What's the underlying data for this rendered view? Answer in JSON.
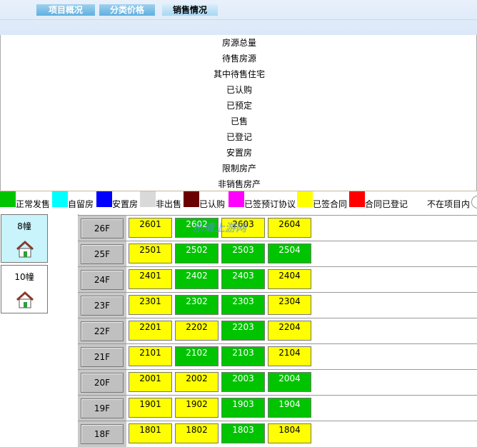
{
  "tabs": [
    {
      "label": "项目概况",
      "active": false
    },
    {
      "label": "分类价格",
      "active": false
    },
    {
      "label": "销售情况",
      "active": true
    }
  ],
  "summary": [
    "房源总量",
    "待售房源",
    "其中待售住宅",
    "已认购",
    "已预定",
    "已售",
    "已登记",
    "安置房",
    "限制房产",
    "非销售房产"
  ],
  "legend": [
    {
      "label": "正常发售",
      "color": "#00c400"
    },
    {
      "label": "自留房",
      "color": "#00ffff"
    },
    {
      "label": "安置房",
      "color": "#0000ff"
    },
    {
      "label": "非出售",
      "color": "#d9d9d9"
    },
    {
      "label": "已认购",
      "color": "#6b0000"
    },
    {
      "label": "已签预订协议",
      "color": "#ff00ff"
    },
    {
      "label": "已签合同",
      "color": "#ffff00"
    },
    {
      "label": "合同已登记",
      "color": "#ff0000"
    },
    {
      "label": "不在项目内",
      "color": "#ffffff"
    }
  ],
  "buildings": [
    {
      "name": "8幢",
      "active": true
    },
    {
      "name": "10幢",
      "active": false
    }
  ],
  "watermark": "乐清上游网",
  "floors": [
    {
      "label": "26F",
      "units": [
        {
          "no": "2601",
          "status": "yellow"
        },
        {
          "no": "2602",
          "status": "green"
        },
        {
          "no": "2603",
          "status": "yellow"
        },
        {
          "no": "2604",
          "status": "yellow"
        }
      ]
    },
    {
      "label": "25F",
      "units": [
        {
          "no": "2501",
          "status": "yellow"
        },
        {
          "no": "2502",
          "status": "green"
        },
        {
          "no": "2503",
          "status": "green"
        },
        {
          "no": "2504",
          "status": "green"
        }
      ]
    },
    {
      "label": "24F",
      "units": [
        {
          "no": "2401",
          "status": "yellow"
        },
        {
          "no": "2402",
          "status": "green"
        },
        {
          "no": "2403",
          "status": "green"
        },
        {
          "no": "2404",
          "status": "yellow"
        }
      ]
    },
    {
      "label": "23F",
      "units": [
        {
          "no": "2301",
          "status": "yellow"
        },
        {
          "no": "2302",
          "status": "green"
        },
        {
          "no": "2303",
          "status": "green"
        },
        {
          "no": "2304",
          "status": "yellow"
        }
      ]
    },
    {
      "label": "22F",
      "units": [
        {
          "no": "2201",
          "status": "yellow"
        },
        {
          "no": "2202",
          "status": "yellow"
        },
        {
          "no": "2203",
          "status": "green"
        },
        {
          "no": "2204",
          "status": "yellow"
        }
      ]
    },
    {
      "label": "21F",
      "units": [
        {
          "no": "2101",
          "status": "yellow"
        },
        {
          "no": "2102",
          "status": "green"
        },
        {
          "no": "2103",
          "status": "green"
        },
        {
          "no": "2104",
          "status": "yellow"
        }
      ]
    },
    {
      "label": "20F",
      "units": [
        {
          "no": "2001",
          "status": "yellow"
        },
        {
          "no": "2002",
          "status": "yellow"
        },
        {
          "no": "2003",
          "status": "green"
        },
        {
          "no": "2004",
          "status": "green"
        }
      ]
    },
    {
      "label": "19F",
      "units": [
        {
          "no": "1901",
          "status": "yellow"
        },
        {
          "no": "1902",
          "status": "yellow"
        },
        {
          "no": "1903",
          "status": "green"
        },
        {
          "no": "1904",
          "status": "green"
        }
      ]
    },
    {
      "label": "18F",
      "units": [
        {
          "no": "1801",
          "status": "yellow"
        },
        {
          "no": "1802",
          "status": "yellow"
        },
        {
          "no": "1803",
          "status": "green"
        },
        {
          "no": "1804",
          "status": "yellow"
        }
      ]
    }
  ]
}
